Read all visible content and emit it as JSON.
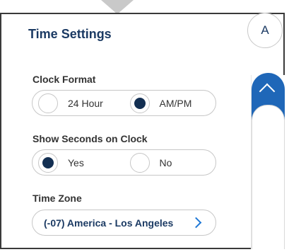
{
  "panel": {
    "title": "Time Settings",
    "avatar_letter": "A"
  },
  "clock_format": {
    "label": "Clock Format",
    "options": [
      {
        "label": "24 Hour",
        "selected": false
      },
      {
        "label": "AM/PM",
        "selected": true
      }
    ]
  },
  "show_seconds": {
    "label": "Show Seconds on Clock",
    "options": [
      {
        "label": "Yes",
        "selected": true
      },
      {
        "label": "No",
        "selected": false
      }
    ]
  },
  "time_zone": {
    "label": "Time Zone",
    "value": "(-07) America - Los Angeles"
  },
  "colors": {
    "accent_blue": "#1f67b8",
    "selected_dot": "#132f52",
    "title_text": "#1b3a63"
  }
}
